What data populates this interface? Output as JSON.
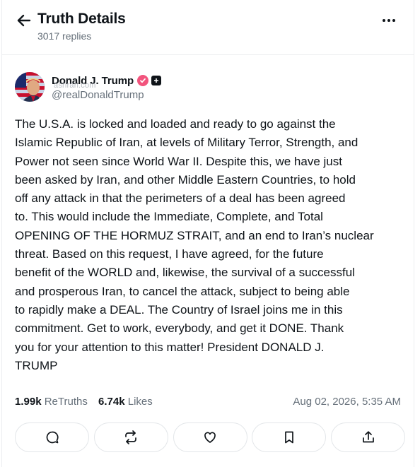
{
  "header": {
    "title": "Truth Details",
    "replies": "3017 replies",
    "back_icon": "arrow-left-icon",
    "more_icon": "more-horizontal-icon"
  },
  "author": {
    "name": "Donald J. Trump",
    "handle": "@realDonaldTrump",
    "verified_color": "#f2547d",
    "watermark": "asriran.com"
  },
  "post": {
    "text": "The U.S.A. is locked and loaded and ready to go against the\nIslamic Republic of Iran, at levels of Military Terror, Strength, and\nPower not seen since World War II. Despite this, we have just\nbeen asked by Iran, and other Middle Eastern Countries, to hold\noff any attack in that the perimeters of a deal has been agreed\nto. This would include the Immediate, Complete, and Total\nOPENING OF THE HORMUZ STRAIT, and an end to Iran’s  nuclear\nthreat. Based on this request, I have agreed, for the future\nbenefit of the WORLD and, likewise, the survival of a successful\nand prosperous Iran, to cancel the attack, subject to being able\nto rapidly make a DEAL. The Country of Israel joins me in this\ncommitment. Get to work, everybody, and get it DONE. Thank\nyou for your attention to this matter! President DONALD J.\nTRUMP"
  },
  "stats": {
    "retruths_count": "1.99k",
    "retruths_label": "ReTruths",
    "likes_count": "6.74k",
    "likes_label": "Likes",
    "timestamp": "Aug 02, 2026, 5:35 AM"
  },
  "actions": [
    {
      "name": "reply",
      "icon": "reply-bubble-icon"
    },
    {
      "name": "retruth",
      "icon": "retruth-icon"
    },
    {
      "name": "like",
      "icon": "heart-icon"
    },
    {
      "name": "bookmark",
      "icon": "bookmark-icon"
    },
    {
      "name": "share",
      "icon": "share-icon"
    }
  ]
}
